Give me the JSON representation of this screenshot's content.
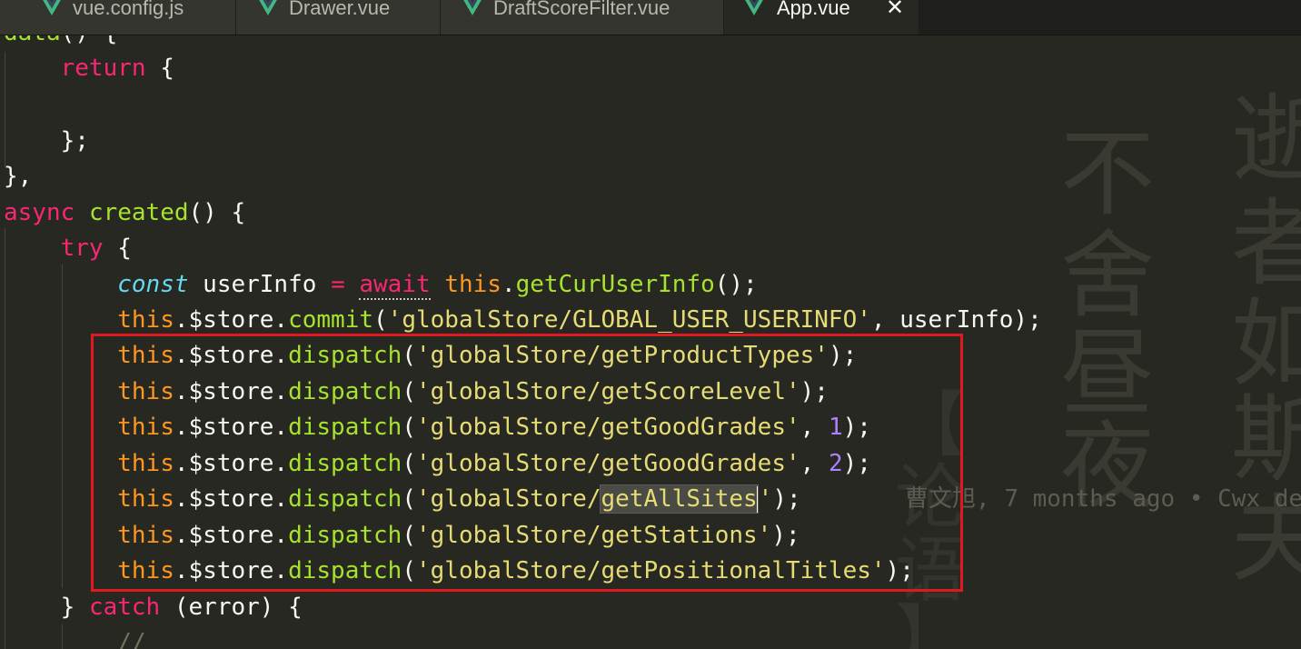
{
  "tabs": [
    {
      "label": "vue.config.js",
      "icon": "vue-icon",
      "active": false
    },
    {
      "label": "Drawer.vue",
      "icon": "vue-icon",
      "active": false
    },
    {
      "label": "DraftScoreFilter.vue",
      "icon": "vue-icon",
      "active": false
    },
    {
      "label": "App.vue",
      "icon": "vue-icon",
      "active": true,
      "close_symbol": "✕"
    }
  ],
  "code": {
    "line_0": {
      "a": "data",
      "b": "() {"
    },
    "line_1": {
      "kw": "return",
      "rest": " {"
    },
    "line_3": {
      "text": "};"
    },
    "line_4": {
      "text": "},"
    },
    "line_5": {
      "kw": "async",
      "fn": "created",
      "rest": "() {"
    },
    "line_6": {
      "kw": "try",
      "rest": " {"
    },
    "line_7": {
      "storage": "const",
      "var": " userInfo ",
      "op": "=",
      "await": "await",
      "this": "this",
      "fn": "getCurUserInfo",
      "rest": "();"
    },
    "line_8": {
      "this": "this",
      "store": ".$store.",
      "fn": "commit",
      "p1": "(",
      "str": "'globalStore/GLOBAL_USER_USERINFO'",
      "rest": ", userInfo);"
    },
    "line_9": {
      "this": "this",
      "store": ".$store.",
      "fn": "dispatch",
      "p1": "(",
      "str": "'globalStore/getProductTypes'",
      "rest": ");"
    },
    "line_10": {
      "this": "this",
      "store": ".$store.",
      "fn": "dispatch",
      "p1": "(",
      "str": "'globalStore/getScoreLevel'",
      "rest": ");"
    },
    "line_11": {
      "this": "this",
      "store": ".$store.",
      "fn": "dispatch",
      "p1": "(",
      "str": "'globalStore/getGoodGrades'",
      "comma": ", ",
      "num": "1",
      "rest": ");"
    },
    "line_12": {
      "this": "this",
      "store": ".$store.",
      "fn": "dispatch",
      "p1": "(",
      "str": "'globalStore/getGoodGrades'",
      "comma": ", ",
      "num": "2",
      "rest": ");"
    },
    "line_13": {
      "this": "this",
      "store": ".$store.",
      "fn": "dispatch",
      "p1": "(",
      "str_a": "'globalStore/",
      "str_hl": "getAllSites",
      "str_b": "'",
      "rest": ");"
    },
    "line_14": {
      "this": "this",
      "store": ".$store.",
      "fn": "dispatch",
      "p1": "(",
      "str": "'globalStore/getStations'",
      "rest": ");"
    },
    "line_15": {
      "this": "this",
      "store": ".$store.",
      "fn": "dispatch",
      "p1": "(",
      "str": "'globalStore/getPositionalTitles'",
      "rest": ");"
    },
    "line_16": {
      "a": "} ",
      "kw": "catch",
      "rest": " (error) {"
    },
    "line_17": {
      "cmt": "//"
    }
  },
  "blame": {
    "author": "曹文旭",
    "text": ", 7 months ago • Cwx de"
  },
  "wallpaper": {
    "col_1": [
      "不",
      "舍",
      "昼",
      "夜"
    ],
    "col_2": [
      "逝",
      "者",
      "如",
      "斯",
      "夫"
    ],
    "col_3": [
      "【",
      "论",
      "语",
      "】"
    ]
  },
  "colors": {
    "background": "#272822",
    "keyword": "#f92672",
    "function": "#a6e22e",
    "string": "#e6db74",
    "this": "#fd971f",
    "number": "#ae81ff",
    "annotation_box": "#e0191f"
  }
}
